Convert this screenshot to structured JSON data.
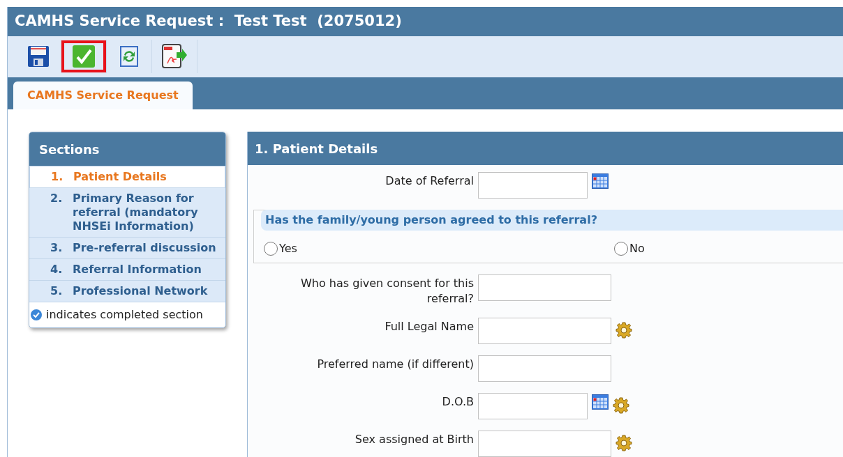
{
  "window": {
    "title": "CAMHS Service Request :  Test Test  (2075012)"
  },
  "toolbar": [
    {
      "kind": "save",
      "highlighted": false
    },
    {
      "kind": "complete",
      "highlighted": true
    },
    {
      "kind": "refresh",
      "highlighted": false
    },
    {
      "kind": "pdf",
      "highlighted": false
    }
  ],
  "tabs": [
    {
      "label": "CAMHS Service Request",
      "selected": true
    }
  ],
  "sections": {
    "title": "Sections",
    "items": [
      {
        "number": "1.",
        "label": "Patient Details",
        "selected": true
      },
      {
        "number": "2.",
        "label": "Primary Reason for referral (mandatory NHSEi Information)",
        "selected": false
      },
      {
        "number": "3.",
        "label": "Pre-referral discussion",
        "selected": false
      },
      {
        "number": "4.",
        "label": "Referral Information",
        "selected": false
      },
      {
        "number": "5.",
        "label": "Professional Network",
        "selected": false
      }
    ],
    "legend": "indicates completed section"
  },
  "panel": {
    "title": "1. Patient Details",
    "rows": [
      {
        "kind": "field",
        "label": "Date of Referral",
        "calendar": true,
        "lookup": false
      },
      {
        "kind": "radio",
        "question": "Has the family/young person agreed to this referral?",
        "options": [
          {
            "label": "Yes",
            "selected": false
          },
          {
            "label": "No",
            "selected": false
          }
        ]
      },
      {
        "kind": "field",
        "label": "Who has given consent for this referral?",
        "calendar": false,
        "lookup": false
      },
      {
        "kind": "field",
        "label": "Full Legal Name",
        "calendar": false,
        "lookup": true
      },
      {
        "kind": "field",
        "label": "Preferred name (if different)",
        "calendar": false,
        "lookup": false
      },
      {
        "kind": "field",
        "label": "D.O.B",
        "calendar": true,
        "lookup": true
      },
      {
        "kind": "field",
        "label": "Sex assigned at Birth",
        "calendar": false,
        "lookup": true
      }
    ]
  }
}
